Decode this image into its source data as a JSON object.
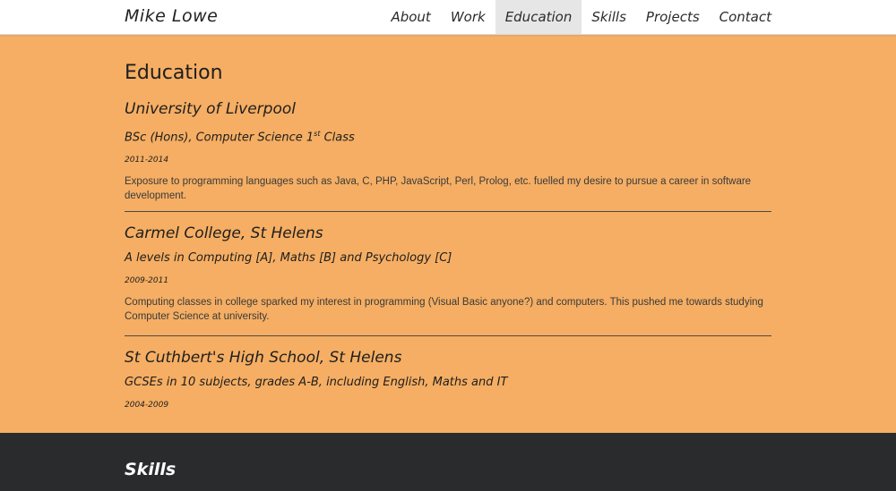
{
  "brand": "Mike Lowe",
  "nav": {
    "items": [
      "About",
      "Work",
      "Education",
      "Skills",
      "Projects",
      "Contact"
    ],
    "active": "Education"
  },
  "education": {
    "title": "Education",
    "entries": [
      {
        "school": "University of Liverpool",
        "qualification": "BSc (Hons), Computer Science 1",
        "qualification_sup": "st",
        "qualification_suffix": " Class",
        "dates": "2011-2014",
        "description": "Exposure to programming languages such as Java, C, PHP, JavaScript, Perl, Prolog, etc. fuelled my desire to pursue a career in software development."
      },
      {
        "school": "Carmel College, St Helens",
        "qualification": "A levels in Computing [A], Maths [B] and Psychology [C]",
        "dates": "2009-2011",
        "description": "Computing classes in college sparked my interest in programming (Visual Basic anyone?) and computers. This pushed me towards studying Computer Science at university."
      },
      {
        "school": "St Cuthbert's High School, St Helens",
        "qualification": "GCSEs in 10 subjects, grades A-B, including English, Maths and IT",
        "dates": "2004-2009",
        "description": ""
      }
    ]
  },
  "skills": {
    "title": "Skills"
  },
  "colors": {
    "education_bg": "#f5ae63",
    "skills_bg": "#2a2b2d",
    "navbar_bg": "#ffffff",
    "nav_active_bg": "#e6e6e6"
  }
}
